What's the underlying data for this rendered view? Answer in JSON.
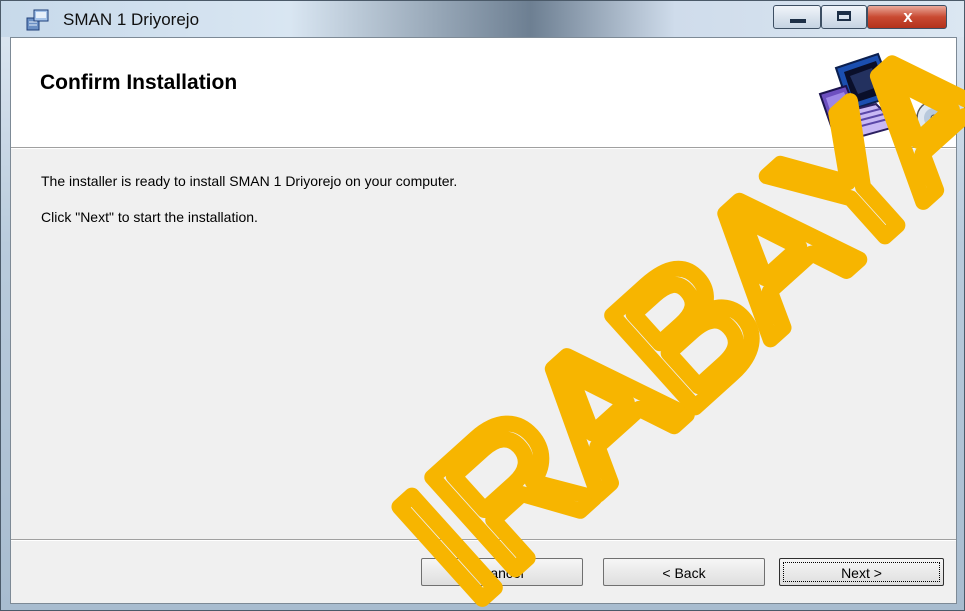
{
  "window": {
    "title": "SMAN 1 Driyorejo",
    "icons": {
      "app": "installer-icon",
      "minimize": "minimize-icon",
      "maximize": "maximize-icon",
      "close": "close-icon"
    },
    "close_glyph": "x"
  },
  "banner": {
    "heading": "Confirm Installation",
    "art_icon": "computer-cd-icon"
  },
  "body": {
    "line1": "The installer is ready to install SMAN 1 Driyorejo on your computer.",
    "line2": "Click \"Next\" to start the installation."
  },
  "buttons": {
    "cancel": "Cancel",
    "back": "< Back",
    "next": "Next >"
  },
  "watermark": {
    "text": "IRABAYA",
    "color": "#f7b500"
  },
  "colors": {
    "close_red": "#c94a32",
    "dialog_bg": "#f0f0f0"
  }
}
